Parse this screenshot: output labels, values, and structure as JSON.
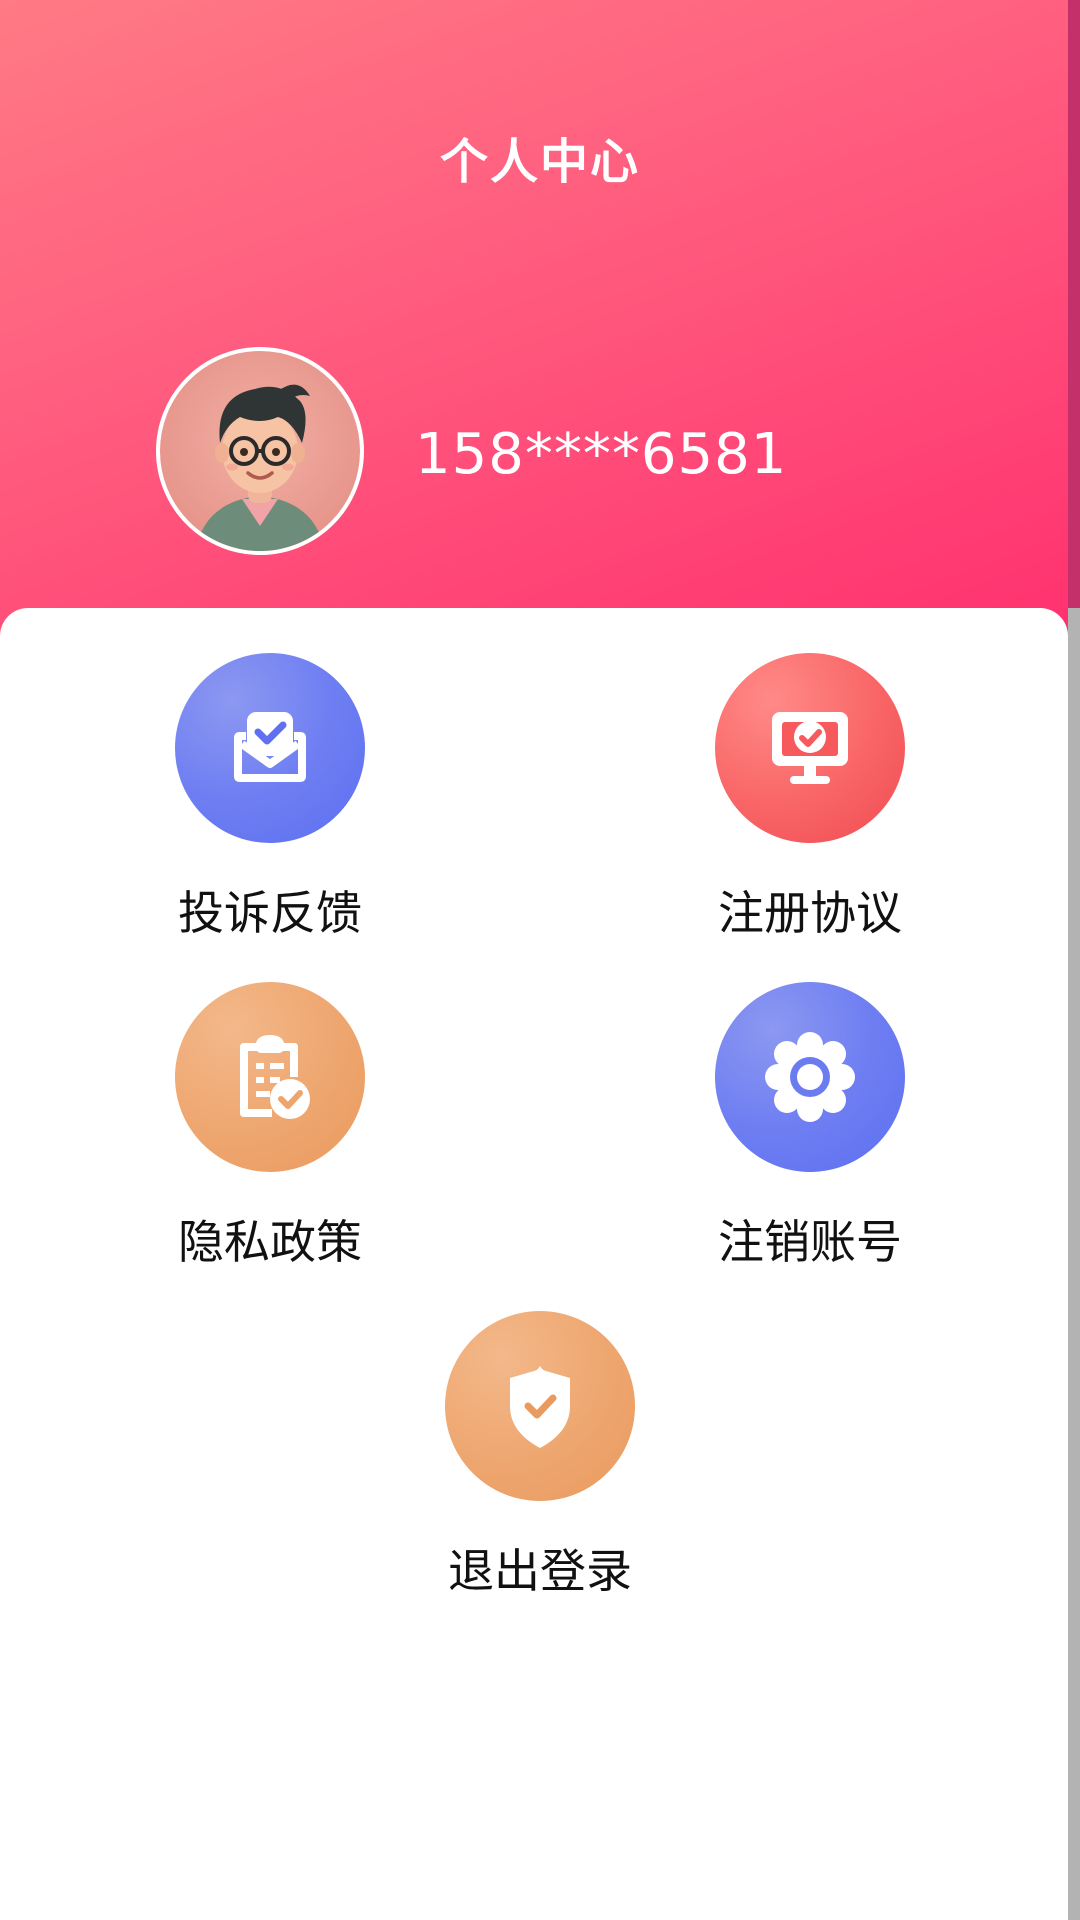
{
  "header": {
    "title": "个人中心"
  },
  "profile": {
    "phone": "158****6581"
  },
  "menu": [
    {
      "label": "投诉反馈",
      "icon": "feedback-inbox-icon",
      "color": "#6b7cf0"
    },
    {
      "label": "注册协议",
      "icon": "monitor-check-icon",
      "color": "#f55f60"
    },
    {
      "label": "隐私政策",
      "icon": "clipboard-check-icon",
      "color": "#eea46d"
    },
    {
      "label": "注销账号",
      "icon": "gear-icon",
      "color": "#6b7cf0"
    },
    {
      "label": "退出登录",
      "icon": "shield-check-icon",
      "color": "#eea46d"
    }
  ]
}
